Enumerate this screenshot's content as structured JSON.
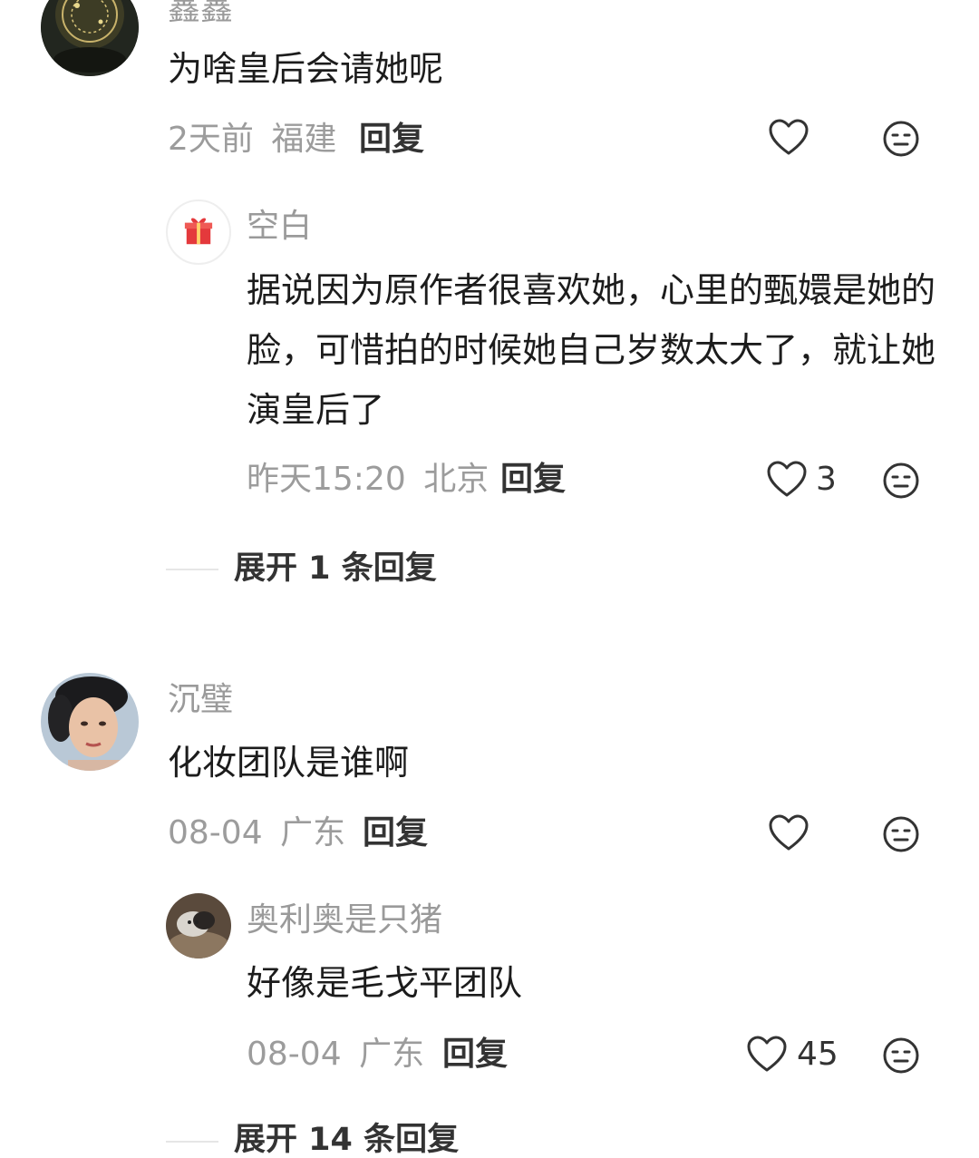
{
  "comments": [
    {
      "author": "鑫鑫",
      "text": "为啥皇后会请她呢",
      "time": "2天前",
      "location": "福建",
      "reply_label": "回复",
      "likes": "",
      "replies": [
        {
          "author": "空白",
          "text": "据说因为原作者很喜欢她，心里的甄嬛是她的脸，可惜拍的时候她自己岁数太大了，就让她演皇后了",
          "time": "昨天15:20",
          "location": "北京",
          "reply_label": "回复",
          "likes": "3"
        }
      ],
      "expand_label": "展开 1 条回复"
    },
    {
      "author": "沉璧",
      "text": "化妆团队是谁啊",
      "time": "08-04",
      "location": "广东",
      "reply_label": "回复",
      "likes": "",
      "replies": [
        {
          "author": "奥利奥是只猪",
          "text": "好像是毛戈平团队",
          "time": "08-04",
          "location": "广东",
          "reply_label": "回复",
          "likes": "45"
        }
      ],
      "expand_label": "展开 14 条回复"
    }
  ],
  "icons": {
    "like": "heart-outline-icon",
    "dislike": "neutral-face-icon",
    "gift": "gift-box-icon"
  },
  "colors": {
    "background": "#ffffff",
    "muted_text": "#9c9c9c",
    "gift_red": "#e4393c"
  }
}
